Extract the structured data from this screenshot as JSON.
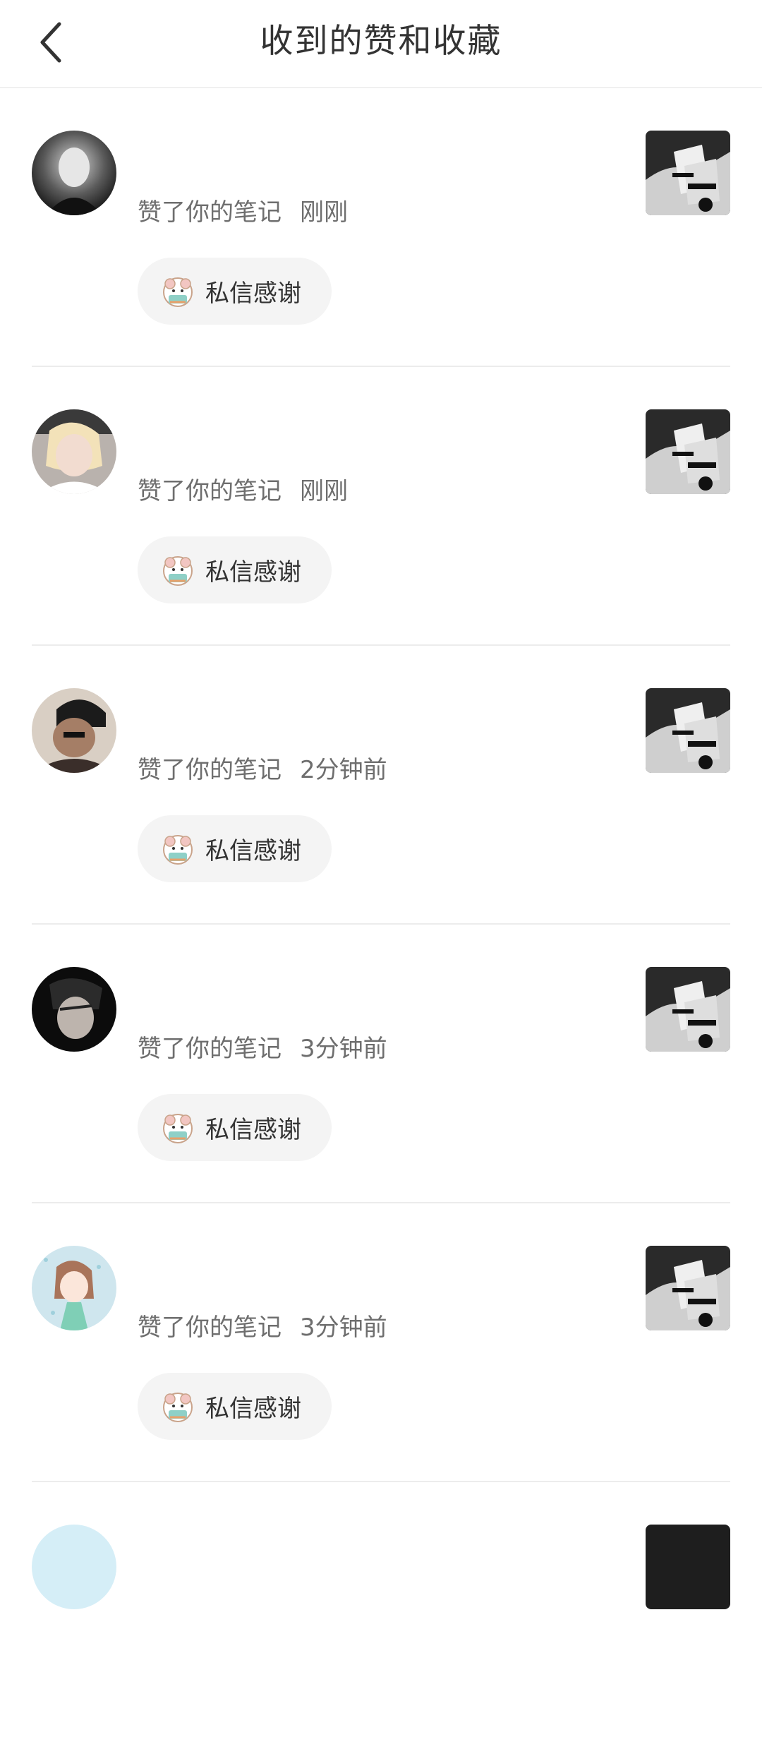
{
  "header": {
    "title": "收到的赞和收藏",
    "back_icon": "chevron-left-icon"
  },
  "notifications": [
    {
      "action": "赞了你的笔记",
      "time": "刚刚",
      "button_label": "私信感谢",
      "avatar_icon": "user-avatar",
      "thumb_icon": "note-thumbnail"
    },
    {
      "action": "赞了你的笔记",
      "time": "刚刚",
      "button_label": "私信感谢",
      "avatar_icon": "user-avatar",
      "thumb_icon": "note-thumbnail"
    },
    {
      "action": "赞了你的笔记",
      "time": "2分钟前",
      "button_label": "私信感谢",
      "avatar_icon": "user-avatar",
      "thumb_icon": "note-thumbnail"
    },
    {
      "action": "赞了你的笔记",
      "time": "3分钟前",
      "button_label": "私信感谢",
      "avatar_icon": "user-avatar",
      "thumb_icon": "note-thumbnail"
    },
    {
      "action": "赞了你的笔记",
      "time": "3分钟前",
      "button_label": "私信感谢",
      "avatar_icon": "user-avatar",
      "thumb_icon": "note-thumbnail"
    }
  ],
  "colors": {
    "text_primary": "#333333",
    "text_secondary": "#6e6e6e",
    "button_bg": "#f4f4f4",
    "divider": "#ececec"
  }
}
